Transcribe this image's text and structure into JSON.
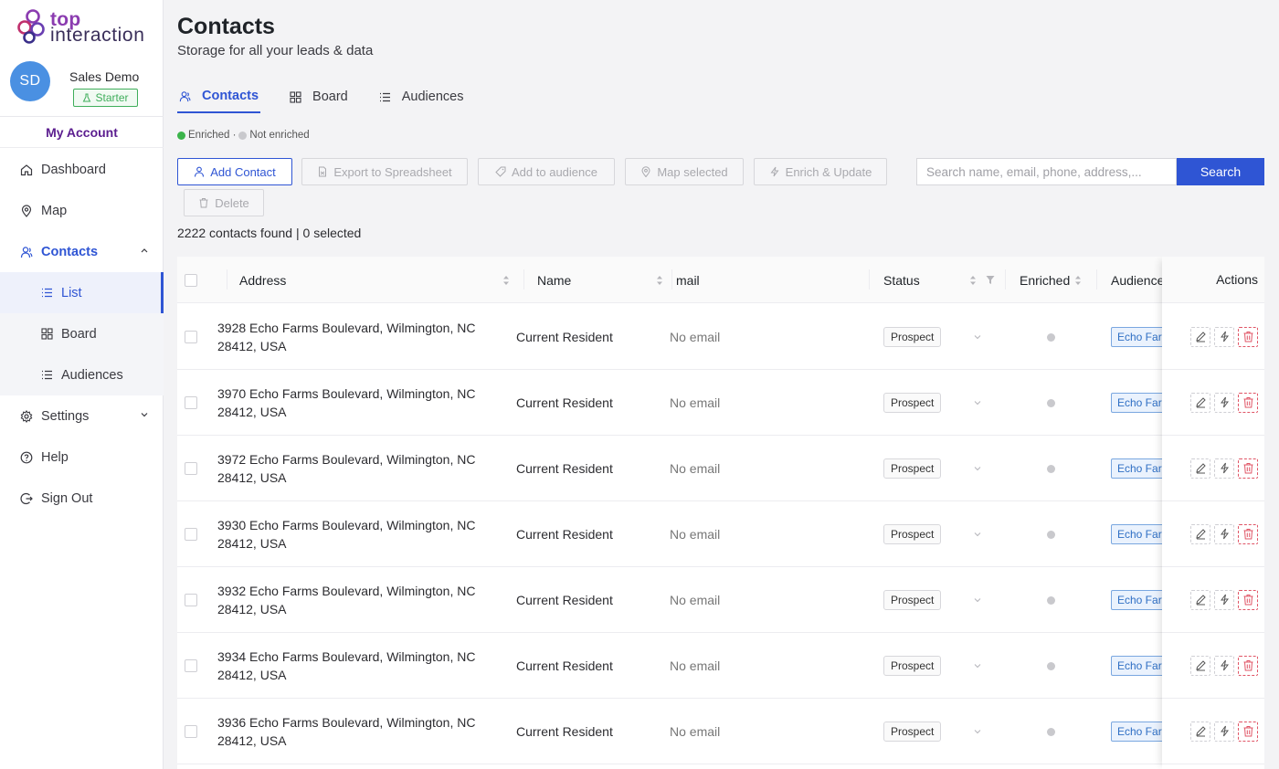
{
  "brand": {
    "line1": "top",
    "line2": "interaction"
  },
  "profile": {
    "initials": "SD",
    "name": "Sales Demo",
    "plan": "Starter"
  },
  "my_account": "My Account",
  "nav": {
    "dashboard": "Dashboard",
    "map": "Map",
    "contacts": "Contacts",
    "list": "List",
    "board": "Board",
    "audiences": "Audiences",
    "settings": "Settings",
    "help": "Help",
    "sign_out": "Sign Out"
  },
  "page": {
    "title": "Contacts",
    "subtitle": "Storage for all your leads & data"
  },
  "tabs": {
    "contacts": "Contacts",
    "board": "Board",
    "audiences": "Audiences"
  },
  "legend": {
    "enriched": "Enriched ·",
    "not_enriched": "Not enriched"
  },
  "toolbar": {
    "add_contact": "Add Contact",
    "export": "Export to Spreadsheet",
    "add_to_audience": "Add to audience",
    "map_selected": "Map selected",
    "enrich_update": "Enrich & Update",
    "delete": "Delete"
  },
  "search": {
    "placeholder": "Search name, email, phone, address,...",
    "button": "Search"
  },
  "count_text": "2222 contacts found | 0 selected",
  "table": {
    "headers": {
      "address": "Address",
      "name": "Name",
      "email": "mail",
      "status": "Status",
      "enriched": "Enriched",
      "audience": "Audience",
      "actions": "Actions"
    },
    "rows": [
      {
        "address_line1": "3928 Echo Farms Boulevard, Wilmington, NC",
        "address_line2": "28412, USA",
        "name": "Current Resident",
        "email": "No email",
        "status": "Prospect",
        "audience": "Echo Farms"
      },
      {
        "address_line1": "3970 Echo Farms Boulevard, Wilmington, NC",
        "address_line2": "28412, USA",
        "name": "Current Resident",
        "email": "No email",
        "status": "Prospect",
        "audience": "Echo Farms"
      },
      {
        "address_line1": "3972 Echo Farms Boulevard, Wilmington, NC",
        "address_line2": "28412, USA",
        "name": "Current Resident",
        "email": "No email",
        "status": "Prospect",
        "audience": "Echo Farms"
      },
      {
        "address_line1": "3930 Echo Farms Boulevard, Wilmington, NC",
        "address_line2": "28412, USA",
        "name": "Current Resident",
        "email": "No email",
        "status": "Prospect",
        "audience": "Echo Farms"
      },
      {
        "address_line1": "3932 Echo Farms Boulevard, Wilmington, NC",
        "address_line2": "28412, USA",
        "name": "Current Resident",
        "email": "No email",
        "status": "Prospect",
        "audience": "Echo Farms"
      },
      {
        "address_line1": "3934 Echo Farms Boulevard, Wilmington, NC",
        "address_line2": "28412, USA",
        "name": "Current Resident",
        "email": "No email",
        "status": "Prospect",
        "audience": "Echo Farms"
      },
      {
        "address_line1": "3936 Echo Farms Boulevard, Wilmington, NC",
        "address_line2": "28412, USA",
        "name": "Current Resident",
        "email": "No email",
        "status": "Prospect",
        "audience": "Echo Farms"
      }
    ]
  },
  "colors": {
    "accent": "#2f55d4",
    "brand_purple": "#8b3cb0",
    "enriched_green": "#3cb44b",
    "danger": "#e05566"
  }
}
